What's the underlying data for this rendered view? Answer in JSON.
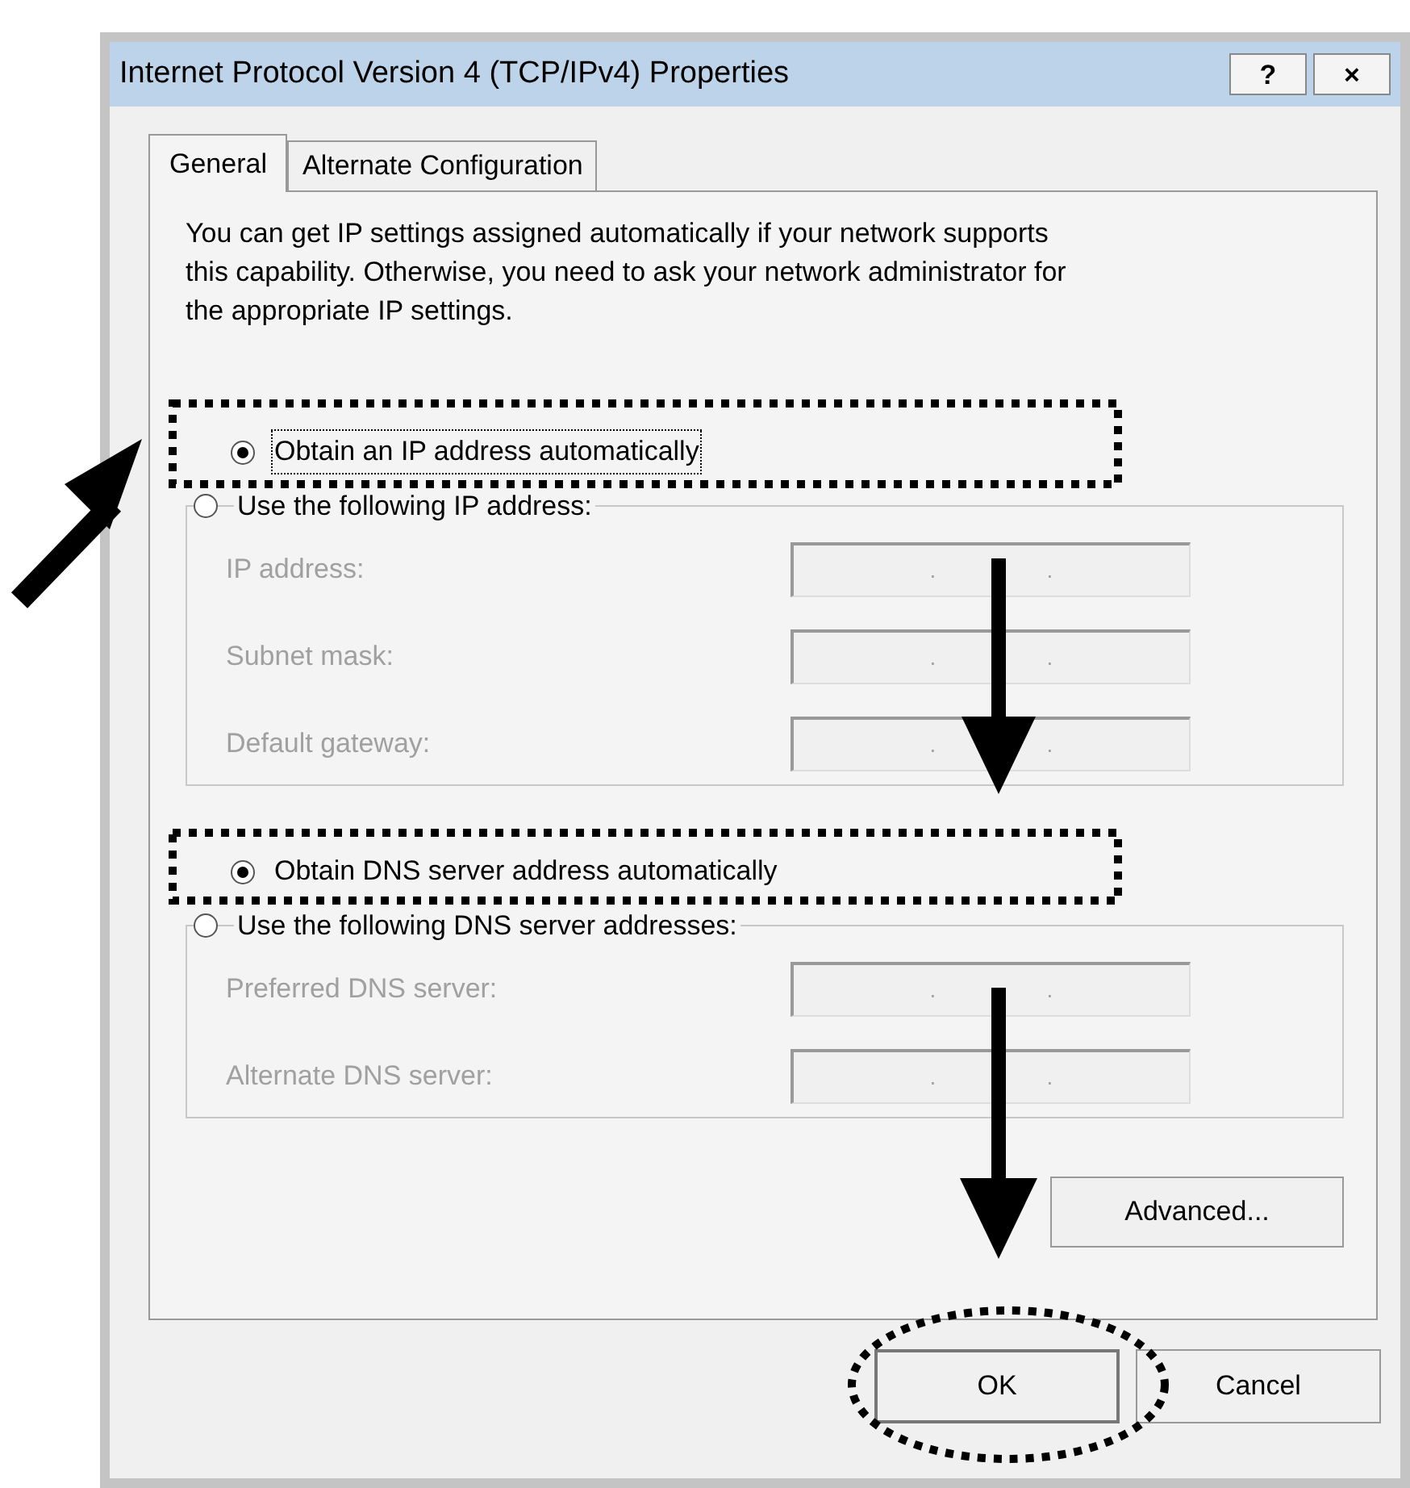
{
  "window": {
    "title": "Internet Protocol Version 4 (TCP/IPv4) Properties",
    "title_buttons": [
      "?",
      "×"
    ]
  },
  "tabs": [
    {
      "label": "General",
      "selected": true
    },
    {
      "label": "Alternate Configuration",
      "selected": false
    }
  ],
  "description": "You can get IP settings assigned automatically if your network supports this capability. Otherwise, you need to ask your network administrator for the appropriate IP settings.",
  "sections": [
    {
      "auto_option": {
        "label": "Obtain an IP address automatically",
        "selected": true,
        "focused": true
      },
      "manual_option": {
        "label": "Use the following IP address:",
        "selected": false
      },
      "fields": [
        {
          "label": "IP address:",
          "disabled": true,
          "separators": [
            ".",
            "."
          ]
        },
        {
          "label": "Subnet mask:",
          "disabled": true,
          "separators": [
            ".",
            "."
          ]
        },
        {
          "label": "Default gateway:",
          "disabled": true,
          "separators": [
            ".",
            "."
          ]
        }
      ]
    },
    {
      "auto_option": {
        "label": "Obtain DNS server address automatically",
        "selected": true,
        "focused": false
      },
      "manual_option": {
        "label": "Use the following DNS server addresses:",
        "selected": false
      },
      "fields": [
        {
          "label": "Preferred DNS server:",
          "disabled": true,
          "separators": [
            ".",
            "."
          ]
        },
        {
          "label": "Alternate DNS server:",
          "disabled": true,
          "separators": [
            ".",
            "."
          ]
        }
      ]
    }
  ],
  "advanced_button": "Advanced...",
  "buttons": [
    {
      "label": "OK",
      "default": true
    },
    {
      "label": "Cancel",
      "default": false
    }
  ]
}
